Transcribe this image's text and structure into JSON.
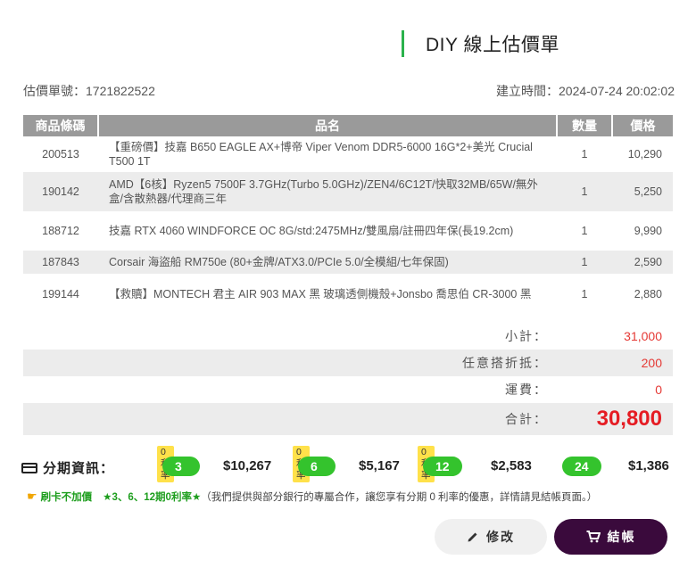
{
  "header": {
    "title": "DIY 線上估價單"
  },
  "meta": {
    "quote_no": "估價單號：1721822522",
    "created": "建立時間：2024-07-24 20:02:02"
  },
  "table": {
    "headers": [
      "商品條碼",
      "品名",
      "數量",
      "價格"
    ],
    "rows": [
      {
        "code": "200513",
        "name": "【重磅價】技嘉 B650 EAGLE AX+博帝 Viper Venom DDR5-6000 16G*2+美光 Crucial T500 1T",
        "qty": "1",
        "price": "10,290"
      },
      {
        "code": "190142",
        "name": "AMD【6核】Ryzen5 7500F 3.7GHz(Turbo 5.0GHz)/ZEN4/6C12T/快取32MB/65W/無外盒/含散熱器/代理商三年",
        "qty": "1",
        "price": "5,250"
      },
      {
        "code": "188712",
        "name": "技嘉 RTX 4060 WINDFORCE OC 8G/std:2475MHz/雙風扇/註冊四年保(長19.2cm)",
        "qty": "1",
        "price": "9,990"
      },
      {
        "code": "187843",
        "name": "Corsair 海盜船 RM750e (80+金牌/ATX3.0/PCIe 5.0/全模組/七年保固)",
        "qty": "1",
        "price": "2,590"
      },
      {
        "code": "199144",
        "name": "【救贖】MONTECH 君主 AIR 903 MAX 黑 玻璃透側機殼+Jonsbo 喬思伯 CR-3000 黑",
        "qty": "1",
        "price": "2,880"
      }
    ]
  },
  "summary": {
    "subtotal_label": "小計：",
    "subtotal": "31,000",
    "discount_label": "任意搭折抵：",
    "discount": "200",
    "shipping_label": "運費：",
    "shipping": "0",
    "total_label": "合計：",
    "total": "30,800"
  },
  "installments": {
    "label": "分期資訊：",
    "plans": [
      {
        "tag": "0利率",
        "period": "3期",
        "price": "$10,267"
      },
      {
        "tag": "0利率",
        "period": "6期",
        "price": "$5,167"
      },
      {
        "tag": "0利率",
        "period": "12期",
        "price": "$2,583"
      },
      {
        "tag": "",
        "period": "24期",
        "price": "$1,386"
      }
    ]
  },
  "notice": {
    "no_surcharge": "刷卡不加價",
    "zero_rate": "★3、6、12期0利率★",
    "text": "（我們提供與部分銀行的專屬合作，讓您享有分期 0 利率的優惠，詳情請見結帳頁面。）"
  },
  "buttons": {
    "edit": "修改",
    "checkout": "結帳"
  },
  "colors": {
    "accent_green": "#34c32d",
    "total_red": "#e51c23",
    "checkout_bg": "#3a0a3c"
  }
}
